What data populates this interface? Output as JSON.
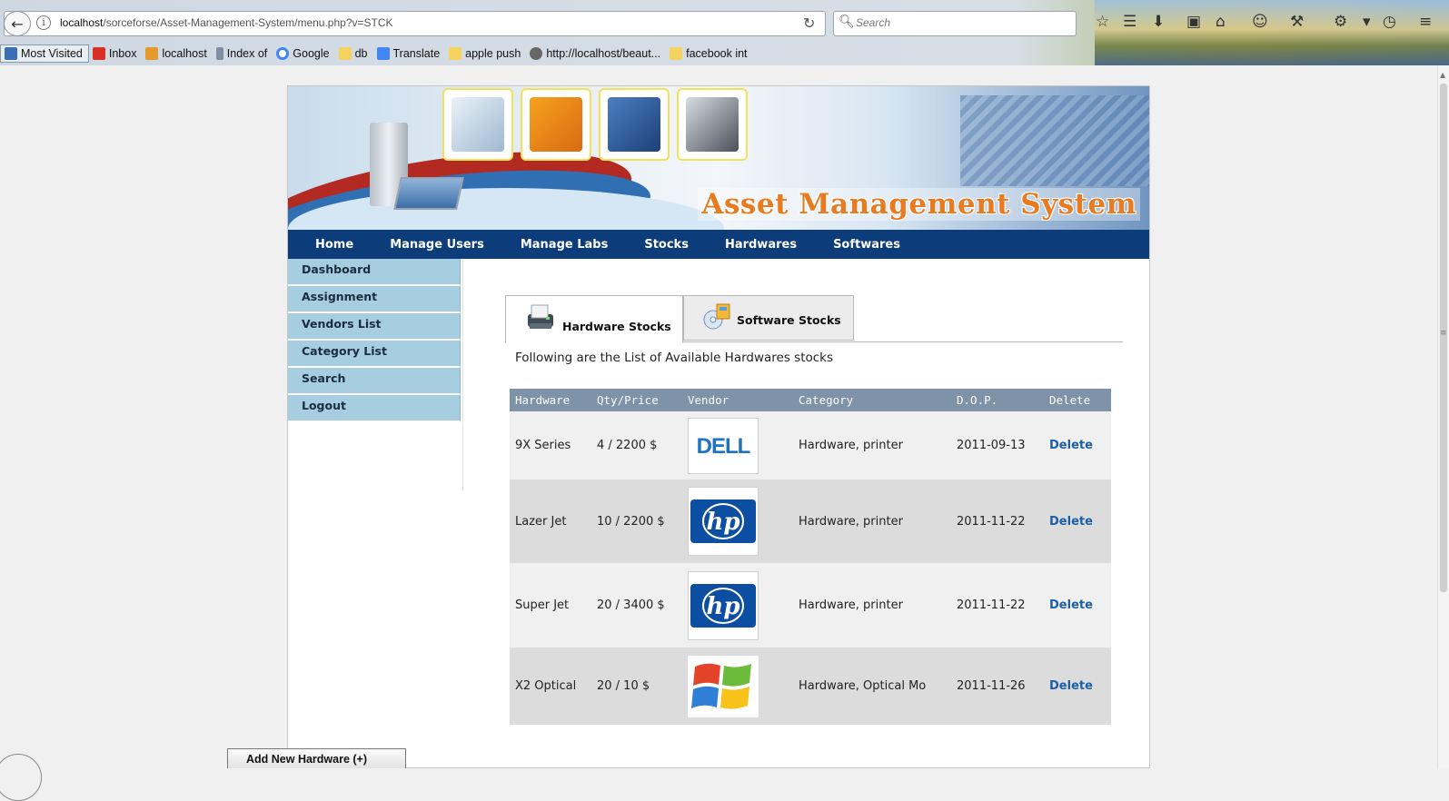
{
  "browser": {
    "url_host": "localhost",
    "url_path": "/sorceforse/Asset-Management-System/menu.php?v=STCK",
    "search_placeholder": "Search",
    "bookmarks": [
      "Most Visited",
      "Inbox",
      "localhost",
      "Index of",
      "Google",
      "db",
      "Translate",
      "apple push",
      "http://localhost/beaut...",
      "facebook int"
    ]
  },
  "site": {
    "banner_title": "Asset Management System",
    "nav": [
      "Home",
      "Manage Users",
      "Manage Labs",
      "Stocks",
      "Hardwares",
      "Softwares"
    ],
    "sidebar": [
      "Dashboard",
      "Assignment",
      "Vendors List",
      "Category List",
      "Search",
      "Logout"
    ],
    "tabs": {
      "hardware": "Hardware Stocks",
      "software": "Software Stocks"
    },
    "intro": "Following are the List of Available Hardwares stocks",
    "table": {
      "headers": [
        "Hardware",
        "Qty/Price",
        "Vendor",
        "Category",
        "D.O.P.",
        "Delete"
      ],
      "rows": [
        {
          "hardware": "9X Series",
          "qty_price": "4 / 2200 $",
          "vendor_logo": "dell-logo",
          "category": "Hardware, printer",
          "dop": "2011-09-13",
          "delete": "Delete"
        },
        {
          "hardware": "Lazer Jet",
          "qty_price": "10 / 2200 $",
          "vendor_logo": "hp-logo",
          "category": "Hardware, printer",
          "dop": "2011-11-22",
          "delete": "Delete"
        },
        {
          "hardware": "Super Jet",
          "qty_price": "20 / 3400 $",
          "vendor_logo": "hp-logo",
          "category": "Hardware, printer",
          "dop": "2011-11-22",
          "delete": "Delete"
        },
        {
          "hardware": "X2 Optical",
          "qty_price": "20 / 10 $",
          "vendor_logo": "windows-logo",
          "category": "Hardware, Optical Mo",
          "dop": "2011-11-26",
          "delete": "Delete"
        }
      ]
    },
    "add_button": "Add New Hardware (+)"
  },
  "colors": {
    "nav_bg": "#0d3c7b",
    "sidebar_bg": "#a7cde1",
    "table_header": "#7e92a8",
    "link": "#1b5fa8",
    "title_orange": "#e87a1f"
  }
}
